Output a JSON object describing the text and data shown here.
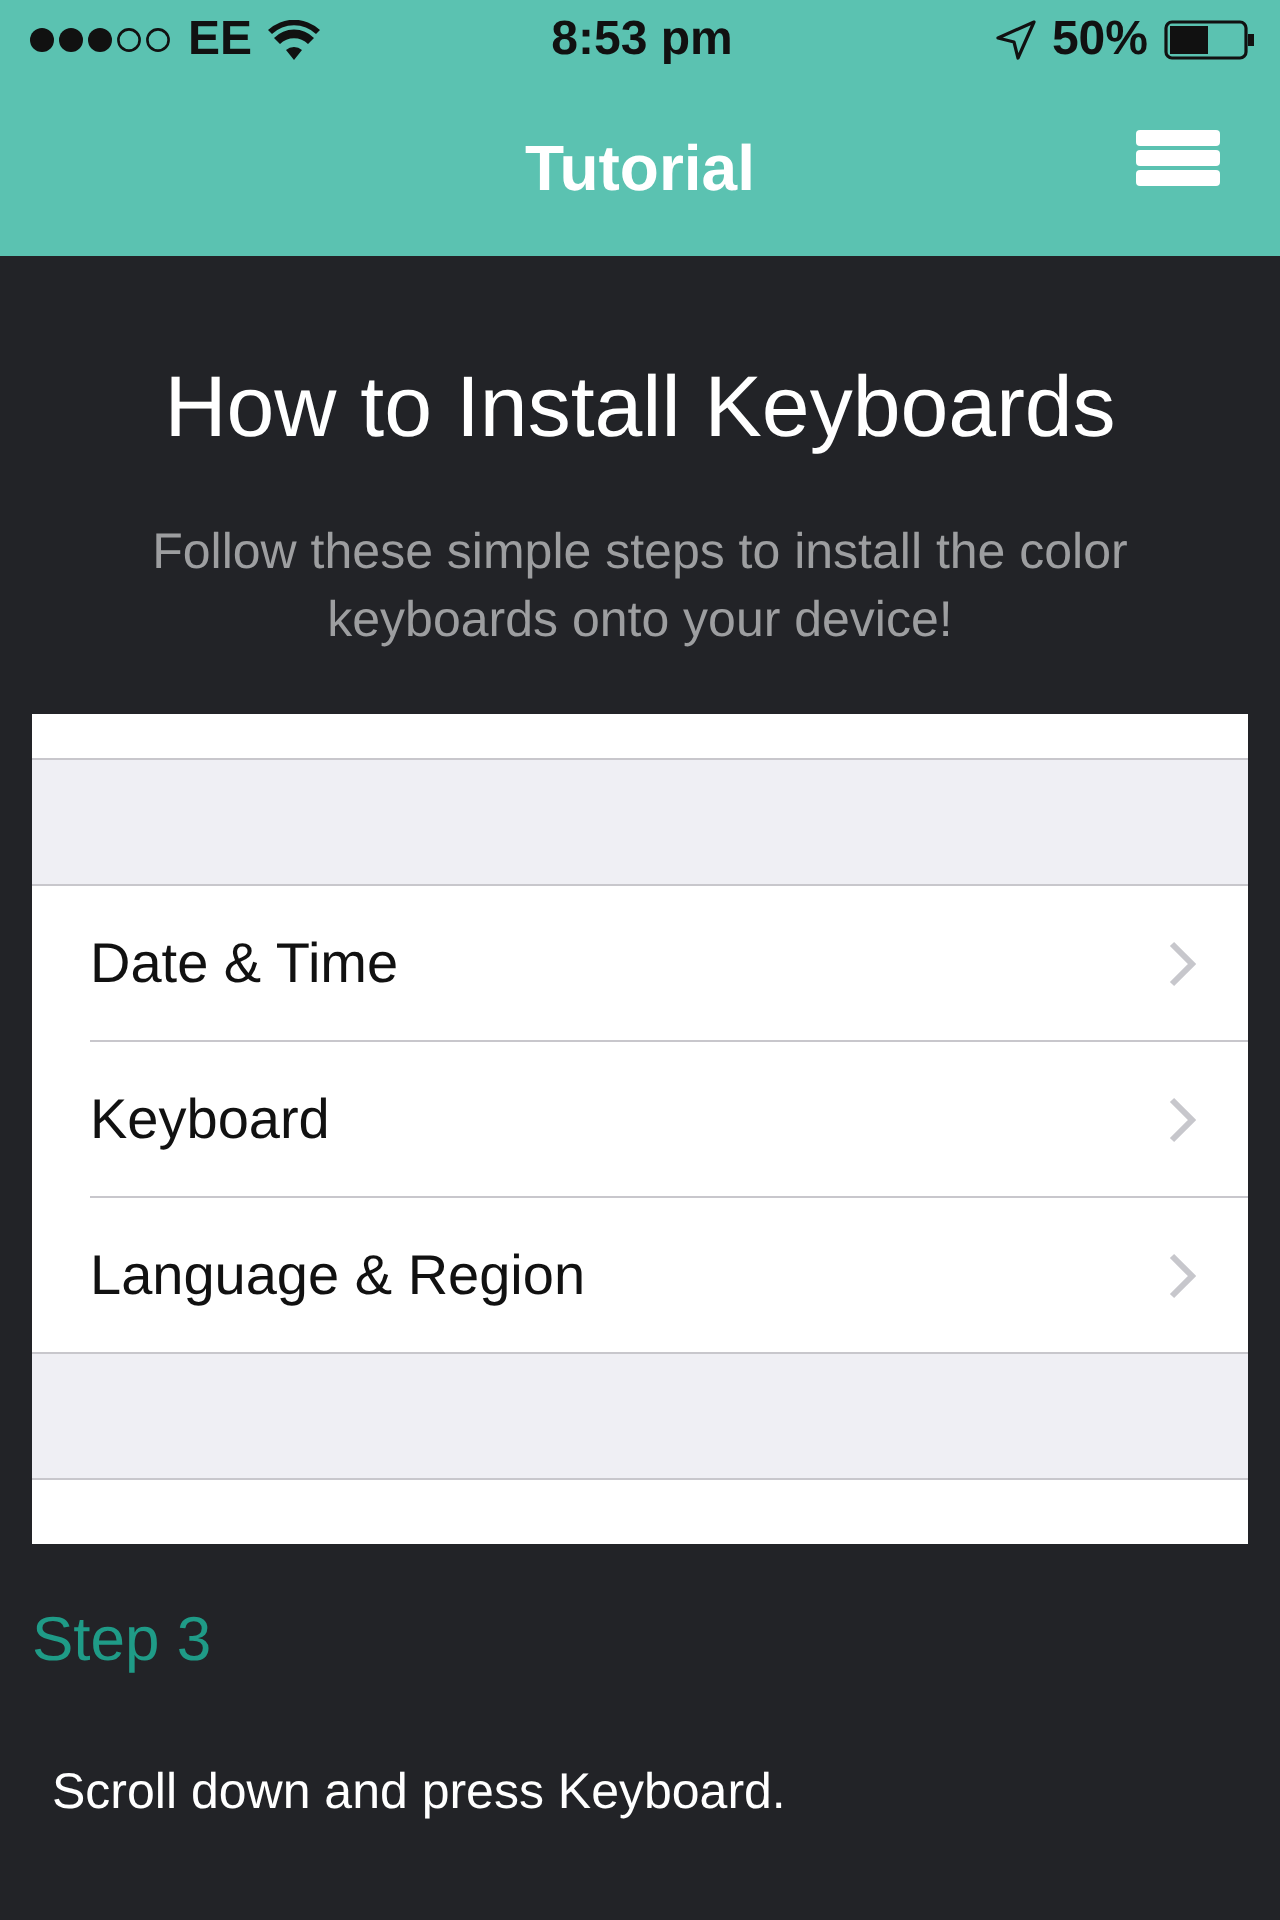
{
  "status_bar": {
    "carrier": "EE",
    "time": "8:53 pm",
    "battery": "50%"
  },
  "nav": {
    "title": "Tutorial"
  },
  "heading": "How to Install Keyboards",
  "subtitle": "Follow these simple steps to install the color keyboards onto your device!",
  "settings_rows": [
    {
      "label": "Date & Time"
    },
    {
      "label": "Keyboard"
    },
    {
      "label": "Language & Region"
    }
  ],
  "step": {
    "title": "Step 3",
    "text": "Scroll down and press Keyboard."
  }
}
